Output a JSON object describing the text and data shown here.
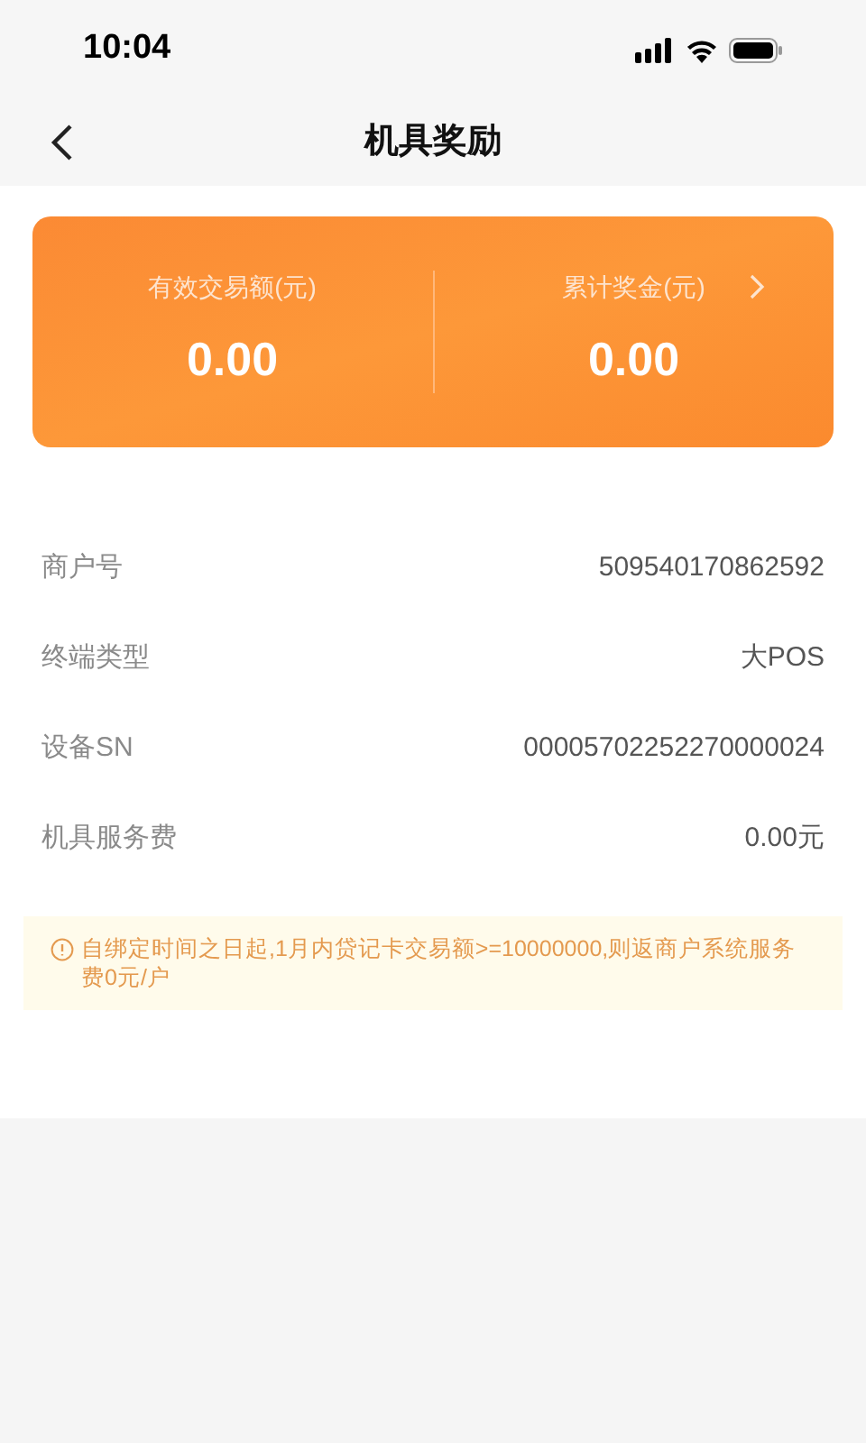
{
  "status_bar": {
    "time": "10:04"
  },
  "nav": {
    "title": "机具奖励"
  },
  "summary": [
    {
      "label": "有效交易额(元)",
      "value": "0.00",
      "has_arrow": false
    },
    {
      "label": "累计奖金(元)",
      "value": "0.00",
      "has_arrow": true
    }
  ],
  "details": [
    {
      "label": "商户号",
      "value": "509540170862592"
    },
    {
      "label": "终端类型",
      "value": "大POS"
    },
    {
      "label": "设备SN",
      "value": "00005702252270000024"
    },
    {
      "label": "机具服务费",
      "value": "0.00元"
    }
  ],
  "notice": {
    "text": "自绑定时间之日起,1月内贷记卡交易额>=10000000,则返商户系统服务费0元/户"
  }
}
